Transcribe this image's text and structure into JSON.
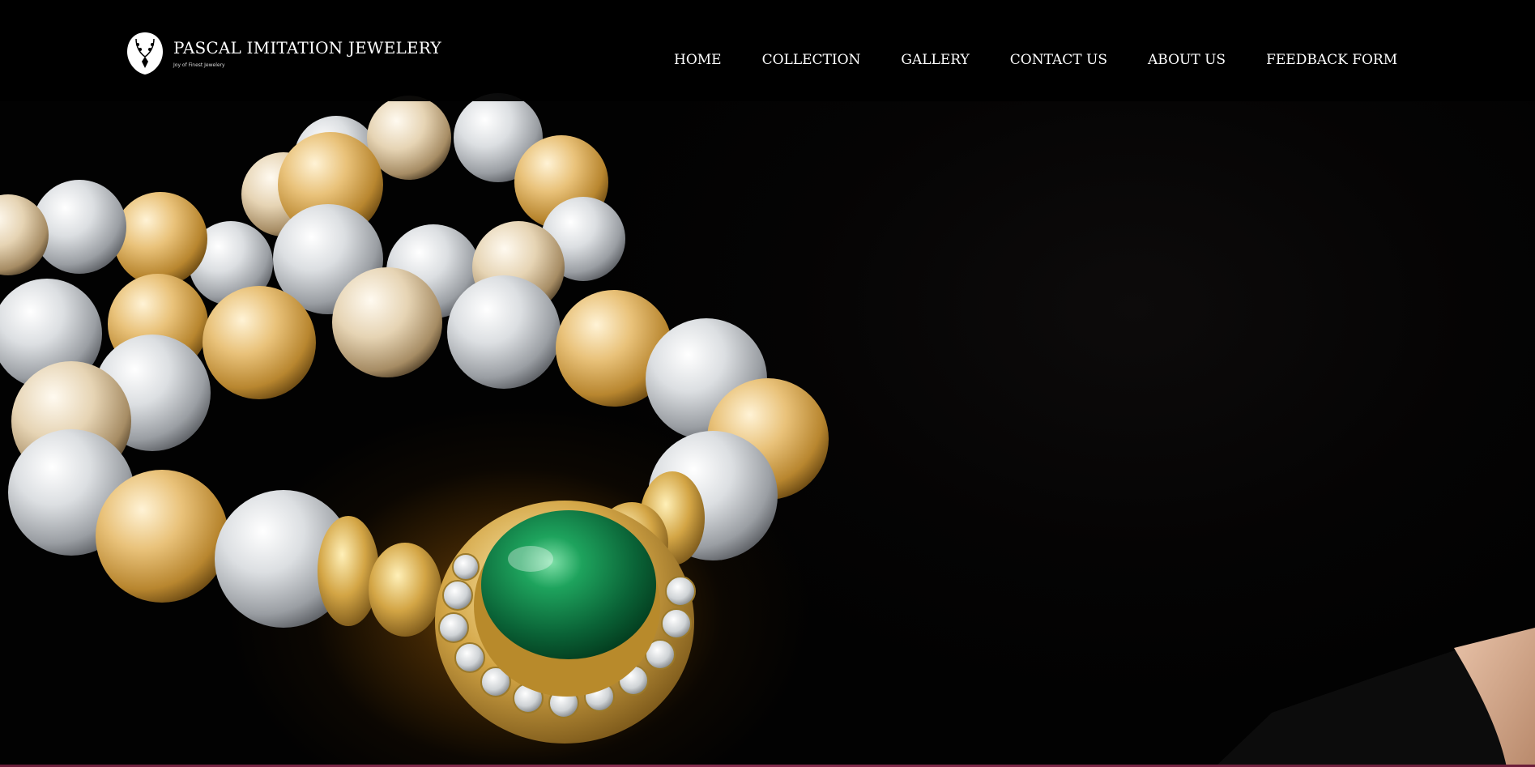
{
  "brand": {
    "name": "PASCAL IMITATION JEWELERY",
    "tagline": "Joy of Finest Jewelery",
    "logo_icon": "necklace-icon"
  },
  "nav": {
    "items": [
      {
        "label": "HOME"
      },
      {
        "label": "COLLECTION"
      },
      {
        "label": "GALLERY"
      },
      {
        "label": "CONTACT US"
      },
      {
        "label": "ABOUT US"
      },
      {
        "label": "FEEDBACK FORM"
      }
    ]
  },
  "colors": {
    "background": "#000000",
    "nav_text": "#ffffff",
    "accent_gold": "#c89a3c",
    "emerald": "#0f7a45"
  }
}
